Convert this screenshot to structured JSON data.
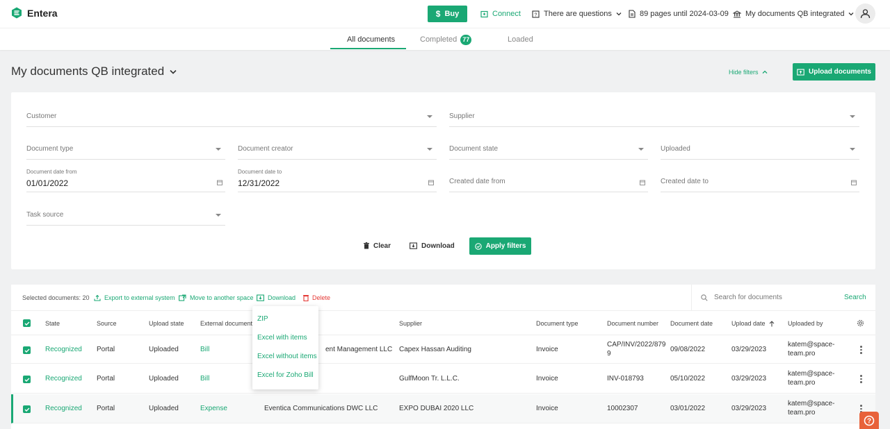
{
  "app": {
    "name": "Entera"
  },
  "topbar": {
    "buy_label": "Buy",
    "connect_label": "Connect",
    "questions_label": "There are questions",
    "pages_label": "89 pages until 2024-03-09",
    "workspace_label": "My documents QB integrated"
  },
  "tabs": {
    "all": "All documents",
    "completed": "Completed",
    "completed_count": "77",
    "loaded": "Loaded"
  },
  "page": {
    "title": "My documents QB integrated",
    "hide_filters": "Hide filters",
    "upload_label": "Upload documents"
  },
  "filters": {
    "customer": "Customer",
    "supplier": "Supplier",
    "document_type": "Document type",
    "document_creator": "Document creator",
    "document_state": "Document state",
    "uploaded": "Uploaded",
    "date_from_label": "Document date from",
    "date_from_value": "01/01/2022",
    "date_to_label": "Document date to",
    "date_to_value": "12/31/2022",
    "created_from": "Created date from",
    "created_to": "Created date to",
    "task_source": "Task source",
    "clear_label": "Clear",
    "download_label": "Download",
    "apply_label": "Apply filters"
  },
  "toolbar": {
    "selected": "Selected documents: 20",
    "export": "Export to external system",
    "move": "Move to another space",
    "download": "Download",
    "delete": "Delete",
    "search_placeholder": "Search for documents",
    "search_label": "Search"
  },
  "table": {
    "headers": {
      "state": "State",
      "source": "Source",
      "upload_state": "Upload state",
      "external": "External document",
      "supplier": "Supplier",
      "doc_type": "Document type",
      "doc_number": "Document number",
      "doc_date": "Document date",
      "upload_date": "Upload date",
      "uploaded_by": "Uploaded by"
    },
    "rows": [
      {
        "state": "Recognized",
        "source": "Portal",
        "upload_state": "Uploaded",
        "external": "Bill",
        "customer": "ent Management LLC",
        "supplier": "Capex Hassan Auditing",
        "doc_type": "Invoice",
        "doc_number_1": "CAP/INV/2022/879",
        "doc_number_2": "9",
        "doc_date": "09/08/2022",
        "upload_date": "03/29/2023",
        "uploaded_by_1": "katem@space-",
        "uploaded_by_2": "team.pro"
      },
      {
        "state": "Recognized",
        "source": "Portal",
        "upload_state": "Uploaded",
        "external": "Bill",
        "customer": "",
        "supplier": "GulfMoon Tr. L.L.C.",
        "doc_type": "Invoice",
        "doc_number_1": "INV-018793",
        "doc_number_2": "",
        "doc_date": "05/10/2022",
        "upload_date": "03/29/2023",
        "uploaded_by_1": "katem@space-",
        "uploaded_by_2": "team.pro"
      },
      {
        "state": "Recognized",
        "source": "Portal",
        "upload_state": "Uploaded",
        "external": "Expense",
        "customer": "Eventica Communications DWC LLC",
        "supplier": "EXPO DUBAI 2020 LLC",
        "doc_type": "Invoice",
        "doc_number_1": "10002307",
        "doc_number_2": "",
        "doc_date": "03/01/2022",
        "upload_date": "03/29/2023",
        "uploaded_by_1": "katem@space-",
        "uploaded_by_2": "team.pro"
      }
    ]
  },
  "download_menu": {
    "items": [
      "ZIP",
      "Excel with items",
      "Excel without items",
      "Excel for Zoho Bill"
    ]
  },
  "colors": {
    "accent": "#1aa874",
    "danger": "#e53935",
    "help": "#e8623a"
  }
}
